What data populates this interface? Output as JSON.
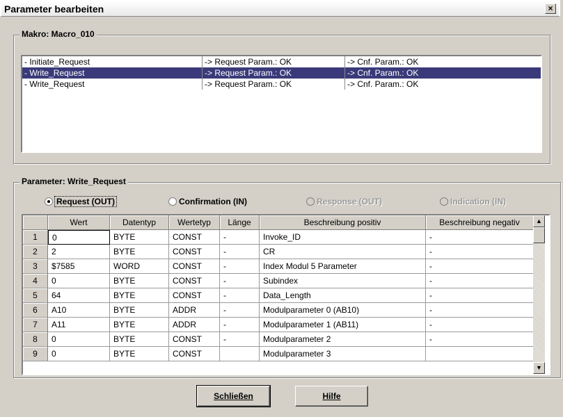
{
  "window": {
    "title": "Parameter bearbeiten",
    "close_glyph": "×"
  },
  "macro_group": {
    "legend": "Makro: Macro_010"
  },
  "macro_rows": [
    {
      "name": "- Initiate_Request",
      "req": "-> Request   Param.: OK",
      "cnf": "-> Cnf. Param.: OK",
      "selected": false
    },
    {
      "name": "- Write_Request",
      "req": "-> Request   Param.: OK",
      "cnf": "-> Cnf. Param.: OK",
      "selected": true
    },
    {
      "name": "- Write_Request",
      "req": "-> Request   Param.: OK",
      "cnf": "-> Cnf. Param.: OK",
      "selected": false
    }
  ],
  "param_group": {
    "legend": "Parameter: Write_Request"
  },
  "radios": [
    {
      "label": "Request (OUT)",
      "checked": true,
      "enabled": true
    },
    {
      "label": "Confirmation (IN)",
      "checked": false,
      "enabled": true
    },
    {
      "label": "Response (OUT)",
      "checked": false,
      "enabled": false
    },
    {
      "label": "Indication (IN)",
      "checked": false,
      "enabled": false
    }
  ],
  "table": {
    "headers": [
      "Wert",
      "Datentyp",
      "Wertetyp",
      "Länge",
      "Beschreibung positiv",
      "Beschreibung negativ"
    ],
    "rows": [
      [
        "1",
        "0",
        "BYTE",
        "CONST",
        "-",
        "Invoke_ID",
        "-"
      ],
      [
        "2",
        "2",
        "BYTE",
        "CONST",
        "-",
        "CR",
        "-"
      ],
      [
        "3",
        "$7585",
        "WORD",
        "CONST",
        "-",
        "Index Modul 5 Parameter",
        "-"
      ],
      [
        "4",
        "0",
        "BYTE",
        "CONST",
        "-",
        "Subindex",
        "-"
      ],
      [
        "5",
        "64",
        "BYTE",
        "CONST",
        "-",
        "Data_Length",
        "-"
      ],
      [
        "6",
        "A10",
        "BYTE",
        "ADDR",
        "-",
        "Modulparameter 0 (AB10)",
        "-"
      ],
      [
        "7",
        "A11",
        "BYTE",
        "ADDR",
        "-",
        "Modulparameter 1 (AB11)",
        "-"
      ],
      [
        "8",
        "0",
        "BYTE",
        "CONST",
        "-",
        "Modulparameter 2",
        "-"
      ],
      [
        "9",
        "0",
        "BYTE",
        "CONST",
        "",
        "Modulparameter 3",
        ""
      ]
    ]
  },
  "buttons": {
    "close": "Schließen",
    "help": "Hilfe"
  },
  "icons": {
    "scroll_up": "▲",
    "scroll_down": "▼"
  }
}
